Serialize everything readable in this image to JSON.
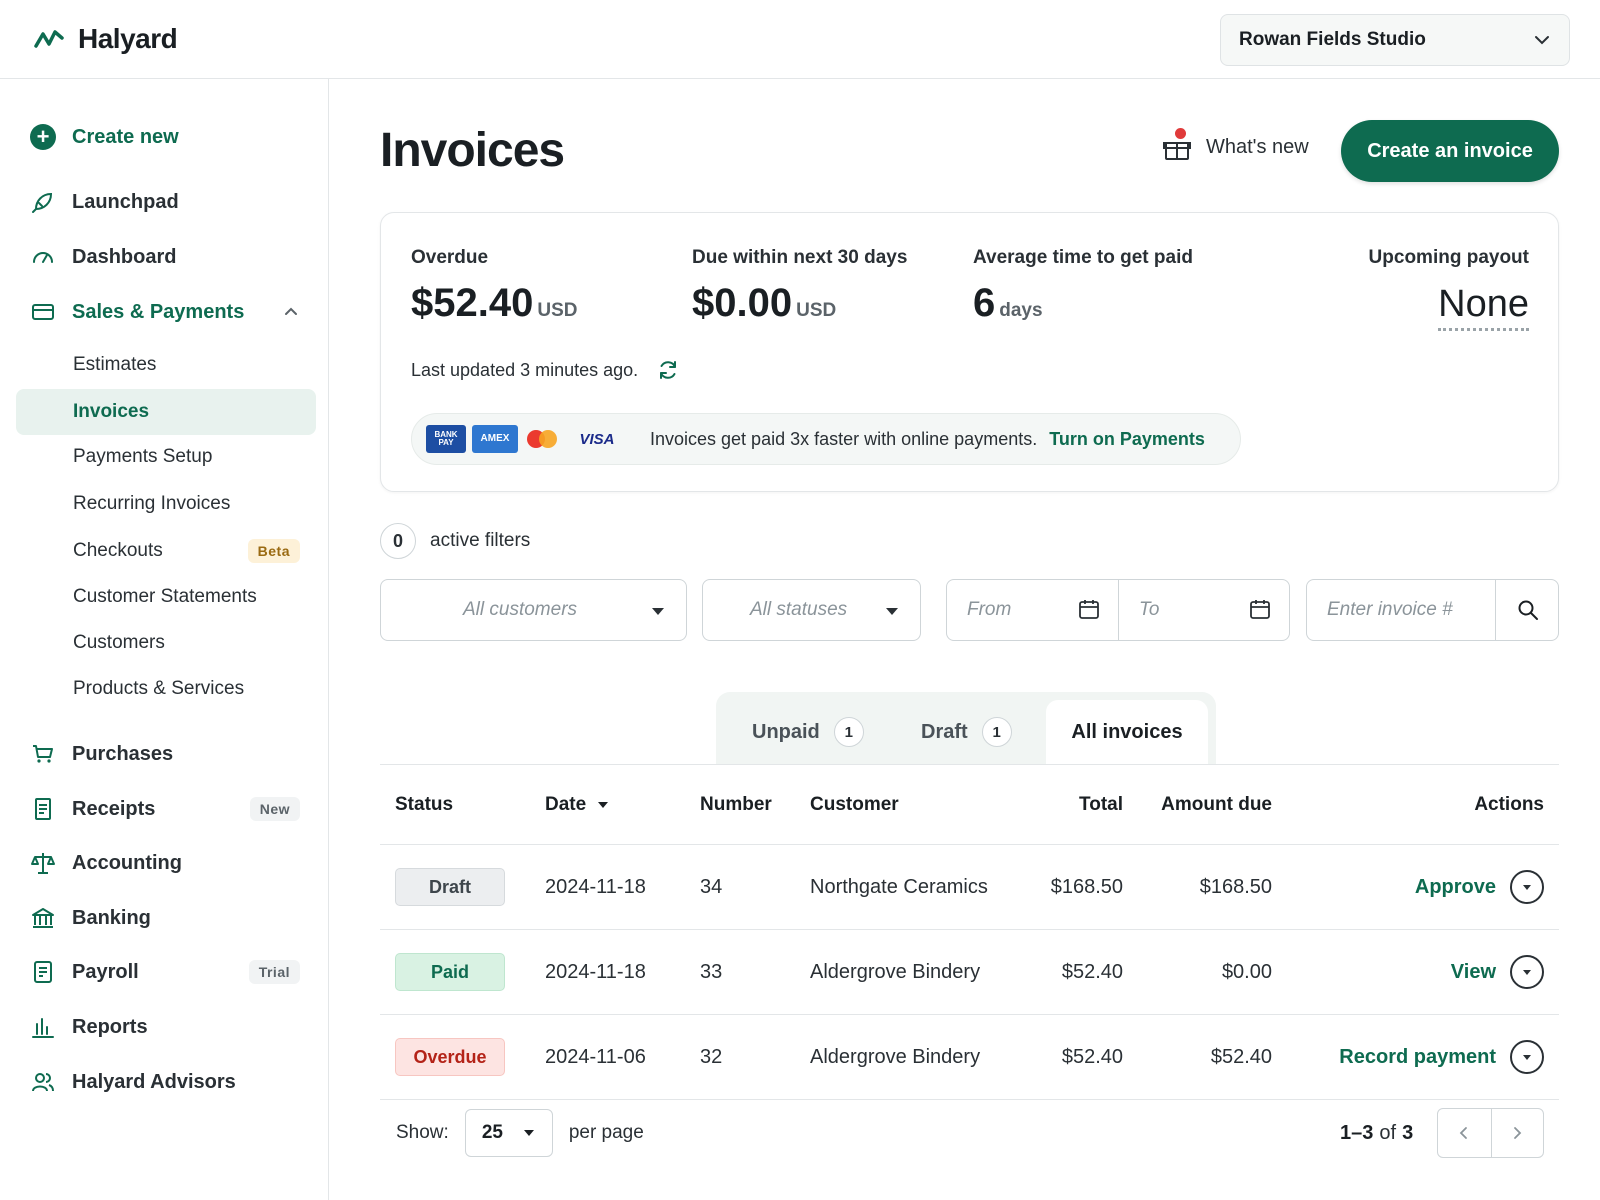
{
  "brand": {
    "name": "Halyard"
  },
  "business": {
    "name": "Rowan Fields Studio"
  },
  "sidebar": {
    "create_new": "Create new",
    "main": [
      {
        "label": "Launchpad",
        "icon": "rocket-icon"
      },
      {
        "label": "Dashboard",
        "icon": "gauge-icon"
      },
      {
        "label": "Sales & Payments",
        "icon": "credit-card-icon",
        "expanded": true
      }
    ],
    "sub": [
      {
        "label": "Estimates"
      },
      {
        "label": "Invoices",
        "selected": true
      },
      {
        "label": "Payments Setup"
      },
      {
        "label": "Recurring Invoices"
      },
      {
        "label": "Checkouts",
        "badge": "Beta"
      },
      {
        "label": "Customer Statements"
      },
      {
        "label": "Customers"
      },
      {
        "label": "Products & Services"
      }
    ],
    "lower": [
      {
        "label": "Purchases",
        "icon": "cart-icon"
      },
      {
        "label": "Receipts",
        "icon": "receipt-icon",
        "badge": "New"
      },
      {
        "label": "Accounting",
        "icon": "scale-icon"
      },
      {
        "label": "Banking",
        "icon": "bank-icon"
      },
      {
        "label": "Payroll",
        "icon": "payroll-icon",
        "badge": "Trial"
      },
      {
        "label": "Reports",
        "icon": "bar-chart-icon"
      },
      {
        "label": "Halyard Advisors",
        "icon": "people-icon"
      }
    ]
  },
  "header": {
    "title": "Invoices",
    "whats_new": "What's new",
    "create_button": "Create an invoice"
  },
  "summary": {
    "overdue": {
      "label": "Overdue",
      "value": "$52.40",
      "unit": "USD"
    },
    "due_soon": {
      "label": "Due within next 30 days",
      "value": "$0.00",
      "unit": "USD"
    },
    "avg_time": {
      "label": "Average time to get paid",
      "value": "6",
      "unit": "days"
    },
    "payout": {
      "label": "Upcoming payout",
      "value": "None"
    },
    "last_updated": "Last updated 3 minutes ago.",
    "banner_text": "Invoices get paid 3x faster with online payments.",
    "banner_link": "Turn on Payments",
    "cards": {
      "bank": "BANK PAY",
      "amex": "AMEX",
      "visa": "VISA"
    }
  },
  "filters": {
    "active_count": "0",
    "active_label": "active filters",
    "customer_placeholder": "All customers",
    "status_placeholder": "All statuses",
    "from_placeholder": "From",
    "to_placeholder": "To",
    "invoice_placeholder": "Enter invoice #"
  },
  "tabs": [
    {
      "label": "Unpaid",
      "count": "1"
    },
    {
      "label": "Draft",
      "count": "1"
    },
    {
      "label": "All invoices",
      "active": true
    }
  ],
  "table": {
    "headers": {
      "status": "Status",
      "date": "Date",
      "number": "Number",
      "customer": "Customer",
      "total": "Total",
      "amount_due": "Amount due",
      "actions": "Actions"
    },
    "rows": [
      {
        "status": "Draft",
        "date": "2024-11-18",
        "number": "34",
        "customer": "Northgate Ceramics",
        "total": "$168.50",
        "amount_due": "$168.50",
        "action": "Approve"
      },
      {
        "status": "Paid",
        "date": "2024-11-18",
        "number": "33",
        "customer": "Aldergrove Bindery",
        "total": "$52.40",
        "amount_due": "$0.00",
        "action": "View"
      },
      {
        "status": "Overdue",
        "date": "2024-11-06",
        "number": "32",
        "customer": "Aldergrove Bindery",
        "total": "$52.40",
        "amount_due": "$52.40",
        "action": "Record payment"
      }
    ]
  },
  "pagination": {
    "show_label": "Show:",
    "per_page_value": "25",
    "per_page_label": "per page",
    "range": "1–3",
    "of_label": "of",
    "total": "3"
  },
  "colors": {
    "accent": "#0e6b50",
    "overdue": "#b42318",
    "paid_bg": "#d9f2e3"
  }
}
